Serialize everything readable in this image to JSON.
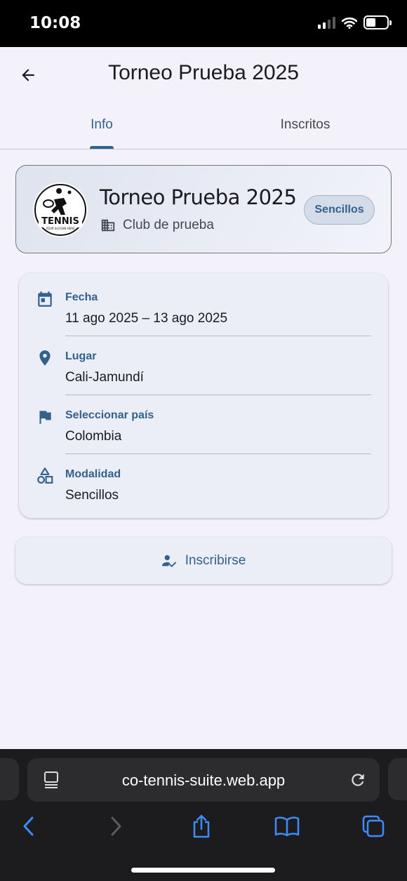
{
  "status_bar": {
    "time": "10:08"
  },
  "app_bar": {
    "title": "Torneo Prueba 2025",
    "back_icon": "arrow-back-icon"
  },
  "tabs": [
    {
      "label": "Info",
      "selected": true
    },
    {
      "label": "Inscritos",
      "selected": false
    }
  ],
  "tournament": {
    "logo": {
      "text": "TENNIS",
      "slogan": "YOUR SLOGAN HERE"
    },
    "name": "Torneo Prueba 2025",
    "club": "Club de prueba",
    "club_icon": "building-icon",
    "chip": "Sencillos"
  },
  "details": [
    {
      "icon": "calendar-icon",
      "label": "Fecha",
      "value": "11 ago 2025 – 13 ago 2025"
    },
    {
      "icon": "location-pin-icon",
      "label": "Lugar",
      "value": "Cali-Jamundí"
    },
    {
      "icon": "flag-icon",
      "label": "Seleccionar país",
      "value": "Colombia"
    },
    {
      "icon": "shapes-icon",
      "label": "Modalidad",
      "value": "Sencillos"
    }
  ],
  "enroll_button": {
    "label": "Inscribirse",
    "icon": "person-check-icon"
  },
  "browser": {
    "url": "co-tennis-suite.web.app"
  },
  "colors": {
    "primary": "#32618d",
    "background": "#f3f2fa",
    "card": "#eceef7",
    "text": "#1b1b1f"
  }
}
